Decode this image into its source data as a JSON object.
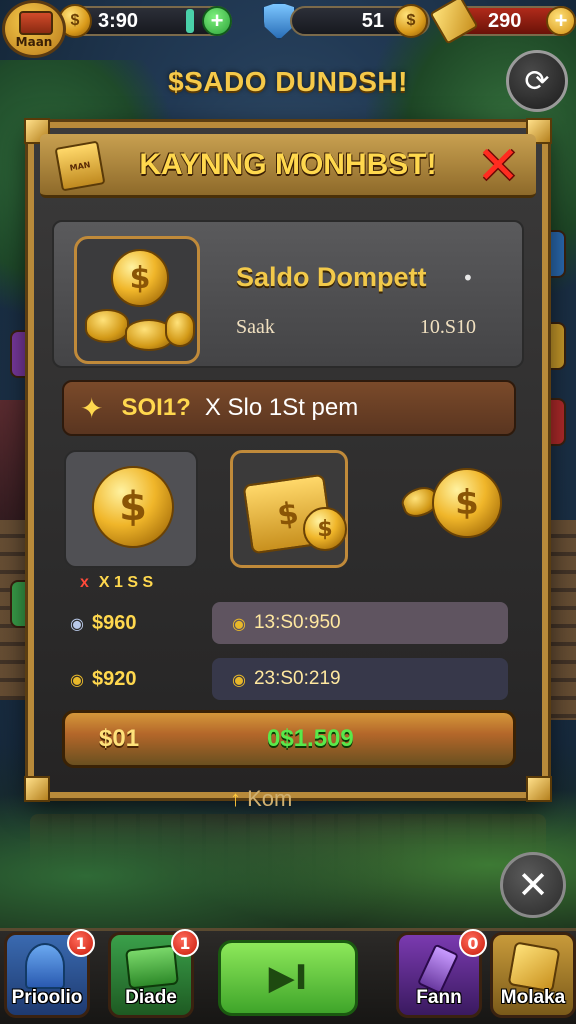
{
  "hud": {
    "main_label": "Maan",
    "stat1_value": "3:90",
    "stat2_value": "51",
    "stat3_value": "290",
    "plus_label": "+"
  },
  "banner": {
    "title": "$SADO DUNDSH!"
  },
  "dialog": {
    "title": "KAYNNG MONHBST!",
    "close_label": "✕",
    "wallet": {
      "title": "Saldo Dompett",
      "dot": "•",
      "subtitle": "Saak",
      "amount": "10.S10"
    },
    "info": {
      "gold_text": "SOI1?",
      "text": "X Slo 1St pem"
    },
    "tiles_caption": {
      "prefix": "x",
      "text": "X 1 S S"
    },
    "rows": [
      {
        "left": "$960",
        "right": "13:S0:950"
      },
      {
        "left": "$920",
        "right": "23:S0:219"
      }
    ],
    "total": {
      "left": "$01",
      "right": "0$1.509"
    }
  },
  "below_label": {
    "arrow": "↑",
    "text": "Kom"
  },
  "nav": {
    "items": [
      {
        "label": "Prioolio",
        "badge": "1"
      },
      {
        "label": "Diade",
        "badge": "1"
      },
      {
        "label": "Fann",
        "badge": "0"
      },
      {
        "label": "Molaka",
        "badge": ""
      }
    ],
    "play_label": "▶I"
  },
  "colors": {
    "accent_gold": "#ffd84e",
    "frame_bronze": "#b88a3a",
    "close_red": "#ff2c20",
    "play_green": "#5ae84a"
  }
}
